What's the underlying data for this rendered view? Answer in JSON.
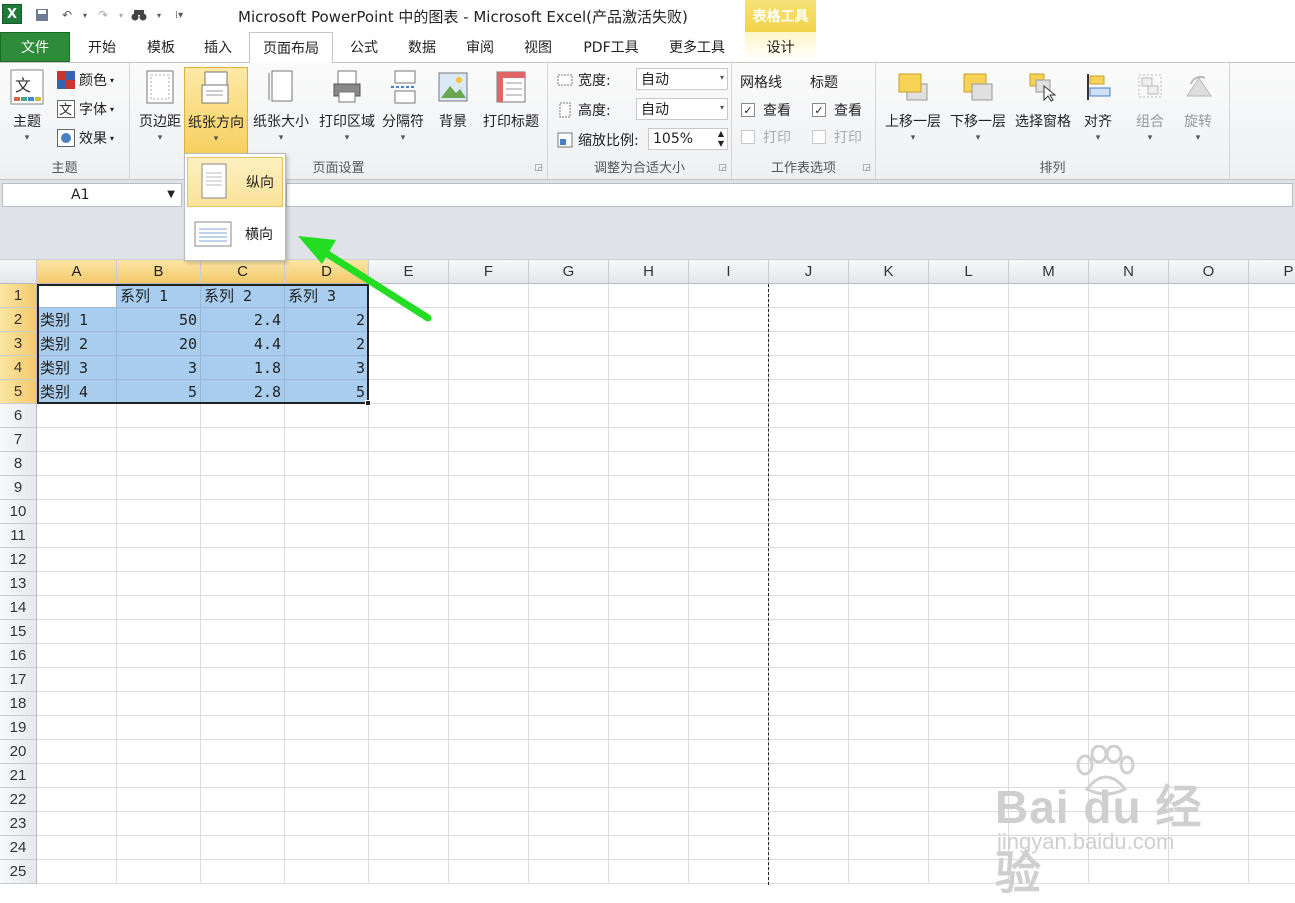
{
  "titlebar": {
    "app_icon": "excel-icon",
    "title": "Microsoft PowerPoint 中的图表 - Microsoft Excel(产品激活失败)",
    "context_header": "表格工具"
  },
  "tabs": {
    "file": "文件",
    "home": "开始",
    "template": "模板",
    "insert": "插入",
    "page_layout": "页面布局",
    "formulas": "公式",
    "data": "数据",
    "review": "审阅",
    "view": "视图",
    "pdf": "PDF工具",
    "more": "更多工具",
    "design": "设计"
  },
  "ribbon": {
    "themes": {
      "label": "主题",
      "themes_btn": "主题",
      "colors": "颜色",
      "fonts": "字体",
      "effects": "效果"
    },
    "page_setup": {
      "label": "页面设置",
      "margins": "页边距",
      "orientation": "纸张方向",
      "size": "纸张大小",
      "print_area": "打印区域",
      "breaks": "分隔符",
      "background": "背景",
      "print_titles": "打印标题"
    },
    "scale": {
      "label": "调整为合适大小",
      "width_label": "宽度:",
      "width_value": "自动",
      "height_label": "高度:",
      "height_value": "自动",
      "scale_label": "缩放比例:",
      "scale_value": "105%"
    },
    "sheet_options": {
      "label": "工作表选项",
      "gridlines": "网格线",
      "headings": "标题",
      "view": "查看",
      "print": "打印"
    },
    "arrange": {
      "label": "排列",
      "bring_forward": "上移一层",
      "send_backward": "下移一层",
      "selection_pane": "选择窗格",
      "align": "对齐",
      "group": "组合",
      "rotate": "旋转"
    }
  },
  "orientation_menu": {
    "portrait": "纵向",
    "landscape": "横向"
  },
  "namebox": {
    "value": "A1"
  },
  "columns": [
    "A",
    "B",
    "C",
    "D",
    "E",
    "F",
    "G",
    "H",
    "I",
    "J",
    "K",
    "L",
    "M",
    "N",
    "O",
    "P"
  ],
  "rows": [
    "1",
    "2",
    "3",
    "4",
    "5",
    "6",
    "7",
    "8",
    "9",
    "10",
    "11",
    "12",
    "13",
    "14",
    "15",
    "16",
    "17",
    "18",
    "19",
    "20",
    "21",
    "22",
    "23",
    "24",
    "25"
  ],
  "sheet": {
    "header": [
      "",
      "系列 1",
      "系列 2",
      "系列 3"
    ],
    "data": [
      [
        "类别 1",
        "50",
        "2.4",
        "2"
      ],
      [
        "类别 2",
        "20",
        "4.4",
        "2"
      ],
      [
        "类别 3",
        "3",
        "1.8",
        "3"
      ],
      [
        "类别 4",
        "5",
        "2.8",
        "5"
      ]
    ]
  },
  "watermark": {
    "logo": "Bai du 经验",
    "url": "jingyan.baidu.com"
  },
  "colors": {
    "file_tab": "#2e8b3a",
    "context_tab": "#f3d34a",
    "selection_fill": "#a8cdee",
    "arrow": "#22dd22"
  }
}
